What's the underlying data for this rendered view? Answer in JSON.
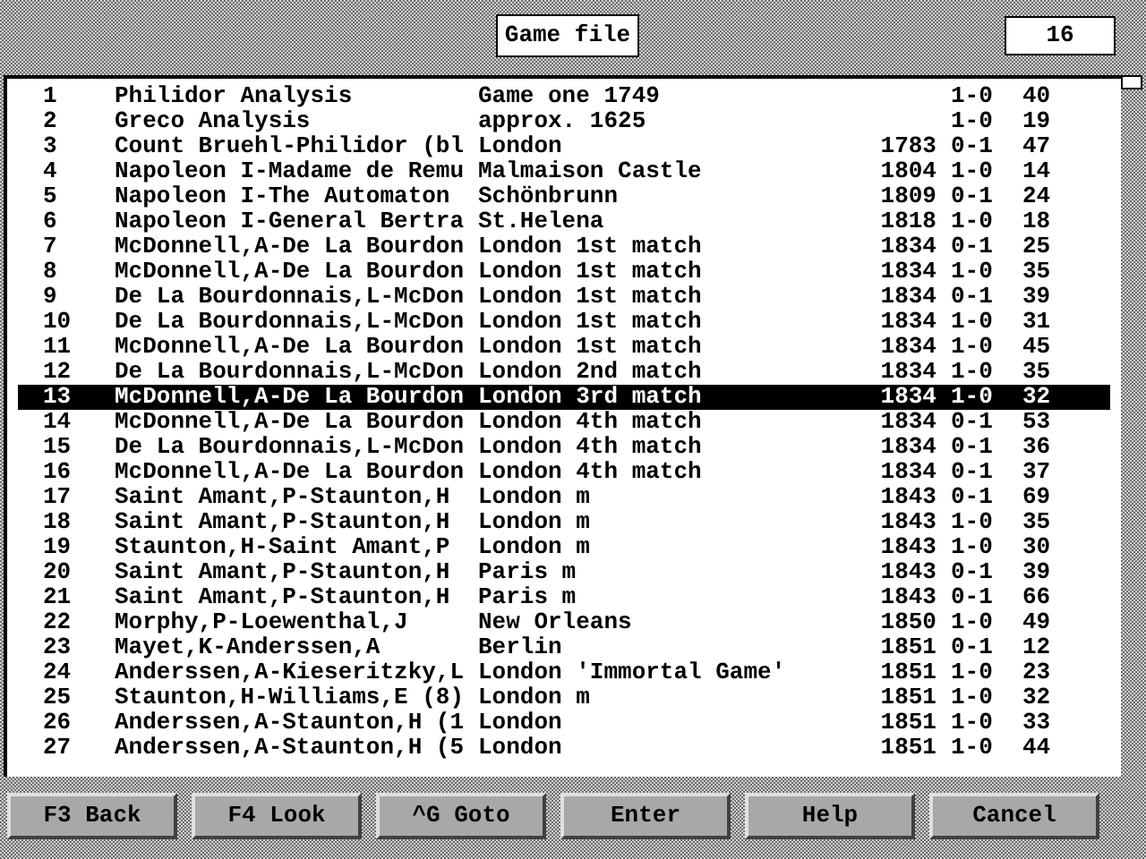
{
  "header": {
    "title": "Game file",
    "count": "16"
  },
  "games": [
    {
      "number": "1",
      "players": "Philidor Analysis",
      "event": "Game one 1749",
      "result": "1-0",
      "moves": "40",
      "selected": false
    },
    {
      "number": "2",
      "players": "Greco Analysis",
      "event": "approx. 1625",
      "result": "1-0",
      "moves": "19",
      "selected": false
    },
    {
      "number": "3",
      "players": "Count Bruehl-Philidor (bl",
      "event": "London",
      "year": "1783",
      "result": "0-1",
      "moves": "47",
      "selected": false
    },
    {
      "number": "4",
      "players": "Napoleon I-Madame de Remu",
      "event": "Malmaison Castle",
      "year": "1804",
      "result": "1-0",
      "moves": "14",
      "selected": false
    },
    {
      "number": "5",
      "players": "Napoleon I-The Automaton",
      "event": "Schönbrunn",
      "year": "1809",
      "result": "0-1",
      "moves": "24",
      "selected": false
    },
    {
      "number": "6",
      "players": "Napoleon I-General Bertra",
      "event": "St.Helena",
      "year": "1818",
      "result": "1-0",
      "moves": "18",
      "selected": false
    },
    {
      "number": "7",
      "players": "McDonnell,A-De La Bourdon",
      "event": "London 1st match",
      "year": "1834",
      "result": "0-1",
      "moves": "25",
      "selected": false
    },
    {
      "number": "8",
      "players": "McDonnell,A-De La Bourdon",
      "event": "London 1st match",
      "year": "1834",
      "result": "1-0",
      "moves": "35",
      "selected": false
    },
    {
      "number": "9",
      "players": "De La Bourdonnais,L-McDon",
      "event": "London 1st match",
      "year": "1834",
      "result": "0-1",
      "moves": "39",
      "selected": false
    },
    {
      "number": "10",
      "players": "De La Bourdonnais,L-McDon",
      "event": "London 1st match",
      "year": "1834",
      "result": "1-0",
      "moves": "31",
      "selected": false
    },
    {
      "number": "11",
      "players": "McDonnell,A-De La Bourdon",
      "event": "London 1st match",
      "year": "1834",
      "result": "1-0",
      "moves": "45",
      "selected": false
    },
    {
      "number": "12",
      "players": "De La Bourdonnais,L-McDon",
      "event": "London 2nd match",
      "year": "1834",
      "result": "1-0",
      "moves": "35",
      "selected": false
    },
    {
      "number": "13",
      "players": "McDonnell,A-De La Bourdon",
      "event": "London 3rd match",
      "year": "1834",
      "result": "1-0",
      "moves": "32",
      "selected": true
    },
    {
      "number": "14",
      "players": "McDonnell,A-De La Bourdon",
      "event": "London 4th match",
      "year": "1834",
      "result": "0-1",
      "moves": "53",
      "selected": false
    },
    {
      "number": "15",
      "players": "De La Bourdonnais,L-McDon",
      "event": "London 4th match",
      "year": "1834",
      "result": "0-1",
      "moves": "36",
      "selected": false
    },
    {
      "number": "16",
      "players": "McDonnell,A-De La Bourdon",
      "event": "London 4th match",
      "year": "1834",
      "result": "0-1",
      "moves": "37",
      "selected": false
    },
    {
      "number": "17",
      "players": "Saint Amant,P-Staunton,H",
      "event": "London m",
      "year": "1843",
      "result": "0-1",
      "moves": "69",
      "selected": false
    },
    {
      "number": "18",
      "players": "Saint Amant,P-Staunton,H",
      "event": "London m",
      "year": "1843",
      "result": "1-0",
      "moves": "35",
      "selected": false
    },
    {
      "number": "19",
      "players": "Staunton,H-Saint Amant,P",
      "event": "London m",
      "year": "1843",
      "result": "1-0",
      "moves": "30",
      "selected": false
    },
    {
      "number": "20",
      "players": "Saint Amant,P-Staunton,H",
      "event": "Paris m",
      "year": "1843",
      "result": "0-1",
      "moves": "39",
      "selected": false
    },
    {
      "number": "21",
      "players": "Saint Amant,P-Staunton,H",
      "event": "Paris m",
      "year": "1843",
      "result": "0-1",
      "moves": "66",
      "selected": false
    },
    {
      "number": "22",
      "players": "Morphy,P-Loewenthal,J",
      "event": "New Orleans",
      "year": "1850",
      "result": "1-0",
      "moves": "49",
      "selected": false
    },
    {
      "number": "23",
      "players": "Mayet,K-Anderssen,A",
      "event": "Berlin",
      "year": "1851",
      "result": "0-1",
      "moves": "12",
      "selected": false
    },
    {
      "number": "24",
      "players": "Anderssen,A-Kieseritzky,L",
      "event": "London 'Immortal Game'",
      "year": "1851",
      "result": "1-0",
      "moves": "23",
      "selected": false
    },
    {
      "number": "25",
      "players": "Staunton,H-Williams,E (8)",
      "event": "London m",
      "year": "1851",
      "result": "1-0",
      "moves": "32",
      "selected": false
    },
    {
      "number": "26",
      "players": "Anderssen,A-Staunton,H (1",
      "event": "London",
      "year": "1851",
      "result": "1-0",
      "moves": "33",
      "selected": false
    },
    {
      "number": "27",
      "players": "Anderssen,A-Staunton,H (5",
      "event": "London",
      "year": "1851",
      "result": "1-0",
      "moves": "44",
      "selected": false
    }
  ],
  "buttons": [
    "F3 Back",
    "F4 Look",
    "^G Goto",
    "Enter",
    "Help",
    "Cancel"
  ]
}
